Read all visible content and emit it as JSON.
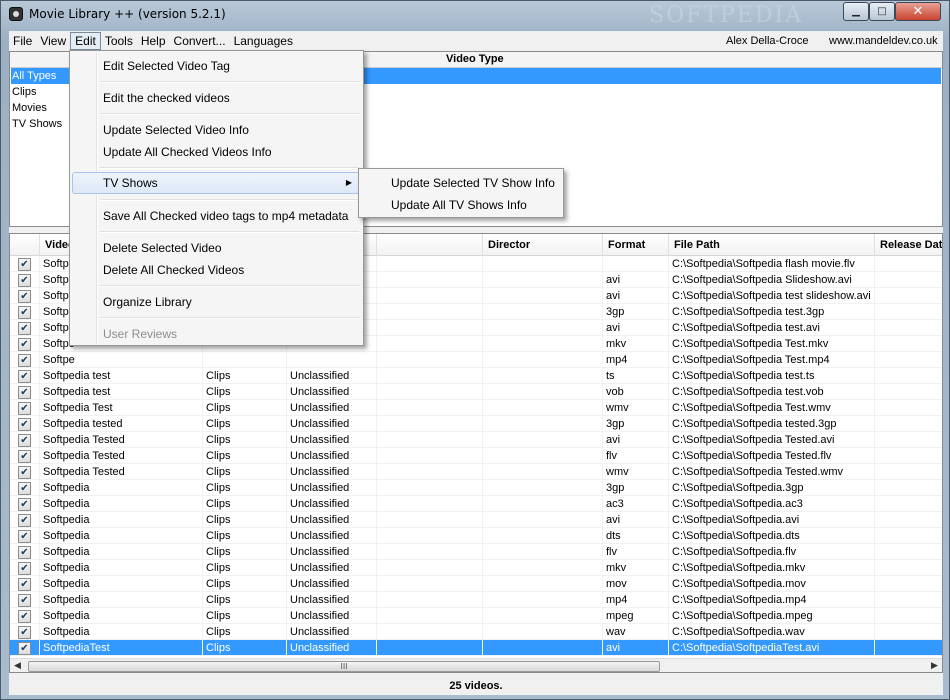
{
  "window": {
    "title": "Movie Library ++ (version 5.2.1)",
    "watermark": "SOFTPEDIA",
    "min_glyph": "▁",
    "max_glyph": "□",
    "close_glyph": "✕"
  },
  "menubar": {
    "items": [
      "File",
      "View",
      "Edit",
      "Tools",
      "Help",
      "Convert...",
      "Languages"
    ],
    "author": "Alex Della-Croce",
    "website": "www.mandeldev.co.uk"
  },
  "type_panel": {
    "header": "Video Type",
    "items": [
      "All Types",
      "Clips",
      "Movies",
      "TV Shows"
    ]
  },
  "edit_menu": {
    "items": [
      {
        "label": "Edit Selected Video Tag"
      },
      {
        "label": "Edit the checked videos"
      },
      {
        "label": "Update Selected Video Info"
      },
      {
        "label": "Update All Checked Videos Info"
      },
      {
        "label": "TV Shows",
        "submenu": true
      },
      {
        "label": "Save All Checked video tags to mp4 metadata"
      },
      {
        "label": "Delete Selected Video"
      },
      {
        "label": "Delete All Checked Videos"
      },
      {
        "label": "Organize Library"
      },
      {
        "label": "User Reviews",
        "disabled": true
      }
    ],
    "submenu_arrow": "▶"
  },
  "tv_submenu": {
    "items": [
      "Update Selected TV Show Info",
      "Update All TV Shows Info"
    ]
  },
  "table": {
    "columns": [
      "",
      "Video",
      "",
      "",
      "",
      "Director",
      "Format",
      "File Path",
      "Release Date"
    ],
    "check_glyph": "✔",
    "rows": [
      {
        "name": "Softpe",
        "type": "",
        "genre": "",
        "format": "",
        "path": "C:\\Softpedia\\Softpedia flash movie.flv"
      },
      {
        "name": "Softpe",
        "type": "",
        "genre": "",
        "format": "avi",
        "path": "C:\\Softpedia\\Softpedia Slideshow.avi"
      },
      {
        "name": "Softpe",
        "type": "",
        "genre": "",
        "format": "avi",
        "path": "C:\\Softpedia\\Softpedia test slideshow.avi"
      },
      {
        "name": "Softpe",
        "type": "",
        "genre": "",
        "format": "3gp",
        "path": "C:\\Softpedia\\Softpedia test.3gp"
      },
      {
        "name": "Softpe",
        "type": "",
        "genre": "",
        "format": "avi",
        "path": "C:\\Softpedia\\Softpedia test.avi"
      },
      {
        "name": "Softpe",
        "type": "",
        "genre": "",
        "format": "mkv",
        "path": "C:\\Softpedia\\Softpedia Test.mkv"
      },
      {
        "name": "Softpe",
        "type": "",
        "genre": "",
        "format": "mp4",
        "path": "C:\\Softpedia\\Softpedia Test.mp4"
      },
      {
        "name": "Softpedia test",
        "type": "Clips",
        "genre": "Unclassified",
        "format": "ts",
        "path": "C:\\Softpedia\\Softpedia test.ts"
      },
      {
        "name": "Softpedia test",
        "type": "Clips",
        "genre": "Unclassified",
        "format": "vob",
        "path": "C:\\Softpedia\\Softpedia test.vob"
      },
      {
        "name": "Softpedia Test",
        "type": "Clips",
        "genre": "Unclassified",
        "format": "wmv",
        "path": "C:\\Softpedia\\Softpedia Test.wmv"
      },
      {
        "name": "Softpedia tested",
        "type": "Clips",
        "genre": "Unclassified",
        "format": "3gp",
        "path": "C:\\Softpedia\\Softpedia tested.3gp"
      },
      {
        "name": "Softpedia Tested",
        "type": "Clips",
        "genre": "Unclassified",
        "format": "avi",
        "path": "C:\\Softpedia\\Softpedia Tested.avi"
      },
      {
        "name": "Softpedia Tested",
        "type": "Clips",
        "genre": "Unclassified",
        "format": "flv",
        "path": "C:\\Softpedia\\Softpedia Tested.flv"
      },
      {
        "name": "Softpedia Tested",
        "type": "Clips",
        "genre": "Unclassified",
        "format": "wmv",
        "path": "C:\\Softpedia\\Softpedia Tested.wmv"
      },
      {
        "name": "Softpedia",
        "type": "Clips",
        "genre": "Unclassified",
        "format": "3gp",
        "path": "C:\\Softpedia\\Softpedia.3gp"
      },
      {
        "name": "Softpedia",
        "type": "Clips",
        "genre": "Unclassified",
        "format": "ac3",
        "path": "C:\\Softpedia\\Softpedia.ac3"
      },
      {
        "name": "Softpedia",
        "type": "Clips",
        "genre": "Unclassified",
        "format": "avi",
        "path": "C:\\Softpedia\\Softpedia.avi"
      },
      {
        "name": "Softpedia",
        "type": "Clips",
        "genre": "Unclassified",
        "format": "dts",
        "path": "C:\\Softpedia\\Softpedia.dts"
      },
      {
        "name": "Softpedia",
        "type": "Clips",
        "genre": "Unclassified",
        "format": "flv",
        "path": "C:\\Softpedia\\Softpedia.flv"
      },
      {
        "name": "Softpedia",
        "type": "Clips",
        "genre": "Unclassified",
        "format": "mkv",
        "path": "C:\\Softpedia\\Softpedia.mkv"
      },
      {
        "name": "Softpedia",
        "type": "Clips",
        "genre": "Unclassified",
        "format": "mov",
        "path": "C:\\Softpedia\\Softpedia.mov"
      },
      {
        "name": "Softpedia",
        "type": "Clips",
        "genre": "Unclassified",
        "format": "mp4",
        "path": "C:\\Softpedia\\Softpedia.mp4"
      },
      {
        "name": "Softpedia",
        "type": "Clips",
        "genre": "Unclassified",
        "format": "mpeg",
        "path": "C:\\Softpedia\\Softpedia.mpeg"
      },
      {
        "name": "Softpedia",
        "type": "Clips",
        "genre": "Unclassified",
        "format": "wav",
        "path": "C:\\Softpedia\\Softpedia.wav"
      },
      {
        "name": "SoftpediaTest",
        "type": "Clips",
        "genre": "Unclassified",
        "format": "avi",
        "path": "C:\\Softpedia\\SoftpediaTest.avi",
        "selected": true
      }
    ]
  },
  "scrollbar": {
    "left": "◀",
    "right": "▶",
    "grip": "III"
  },
  "status": {
    "text": "25 videos."
  }
}
